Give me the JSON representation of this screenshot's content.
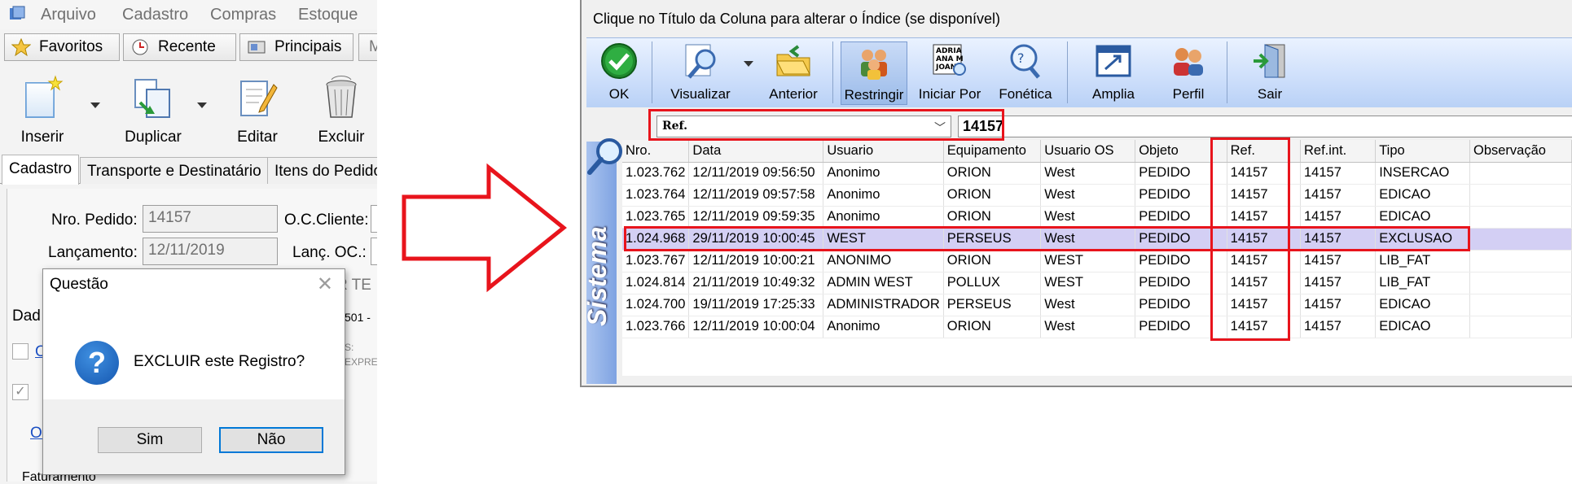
{
  "left_app": {
    "menu": [
      "Arquivo",
      "Cadastro",
      "Compras",
      "Estoque"
    ],
    "favbar": [
      "Favoritos",
      "Recente",
      "Principais"
    ],
    "toolbar": [
      "Inserir",
      "Duplicar",
      "Editar",
      "Excluir"
    ],
    "tabs": [
      "Cadastro",
      "Transporte e Destinatário",
      "Itens do Pedido"
    ],
    "form": {
      "nro_pedido_label": "Nro. Pedido:",
      "nro_pedido_value": "14157",
      "lancamento_label": "Lançamento:",
      "lancamento_value": "12/11/2019",
      "oc_cliente_label": "O.C.Cliente:",
      "lanc_oc_label": "Lanç. OC.:",
      "partial_dad": "Dad",
      "partial_o1": "O",
      "partial_o2": "Ol",
      "partial_rte": "R TE",
      "partial_501": "501 -",
      "partial_s": "S:",
      "partial_expre": "EXPRE",
      "faturamento": "Faturamento"
    },
    "dialog": {
      "title": "Questão",
      "message": "EXCLUIR este Registro?",
      "yes": "Sim",
      "no": "Não"
    }
  },
  "right_win": {
    "title": "Clique no Título da Coluna para alterar o Índice (se disponível)",
    "toolbar": [
      "OK",
      "Visualizar",
      "Anterior",
      "Restringir",
      "Iniciar Por",
      "Fonética",
      "Amplia",
      "Perfil",
      "Sair"
    ],
    "combo_value": "Ref.",
    "search_value": "14157",
    "side_label": "Sistema",
    "columns": [
      "Nro.",
      "Data",
      "Usuario",
      "Equipamento",
      "Usuario OS",
      "Objeto",
      "Ref.",
      "Ref.int.",
      "Tipo",
      "Observação"
    ],
    "rows": [
      [
        "1.023.762",
        "12/11/2019 09:56:50",
        "Anonimo",
        "ORION",
        "West",
        "PEDIDO",
        "14157",
        "14157",
        "INSERCAO",
        ""
      ],
      [
        "1.023.764",
        "12/11/2019 09:57:58",
        "Anonimo",
        "ORION",
        "West",
        "PEDIDO",
        "14157",
        "14157",
        "EDICAO",
        ""
      ],
      [
        "1.023.765",
        "12/11/2019 09:59:35",
        "Anonimo",
        "ORION",
        "West",
        "PEDIDO",
        "14157",
        "14157",
        "EDICAO",
        ""
      ],
      [
        "1.024.968",
        "29/11/2019 10:00:45",
        "WEST",
        "PERSEUS",
        "West",
        "PEDIDO",
        "14157",
        "14157",
        "EXCLUSAO",
        ""
      ],
      [
        "1.023.767",
        "12/11/2019 10:00:21",
        "ANONIMO",
        "ORION",
        "WEST",
        "PEDIDO",
        "14157",
        "14157",
        "LIB_FAT",
        ""
      ],
      [
        "1.024.814",
        "21/11/2019 10:49:32",
        "ADMIN WEST",
        "POLLUX",
        "WEST",
        "PEDIDO",
        "14157",
        "14157",
        "LIB_FAT",
        ""
      ],
      [
        "1.024.700",
        "19/11/2019 17:25:33",
        "ADMINISTRADOR",
        "PERSEUS",
        "West",
        "PEDIDO",
        "14157",
        "14157",
        "EDICAO",
        ""
      ],
      [
        "1.023.766",
        "12/11/2019 10:00:04",
        "Anonimo",
        "ORION",
        "West",
        "PEDIDO",
        "14157",
        "14157",
        "EDICAO",
        ""
      ]
    ],
    "selected_row": 3
  },
  "colors": {
    "highlight_red": "#e8141c",
    "selected_row": "#d3cff4",
    "toolbar_blue": "#cfe0fb"
  }
}
